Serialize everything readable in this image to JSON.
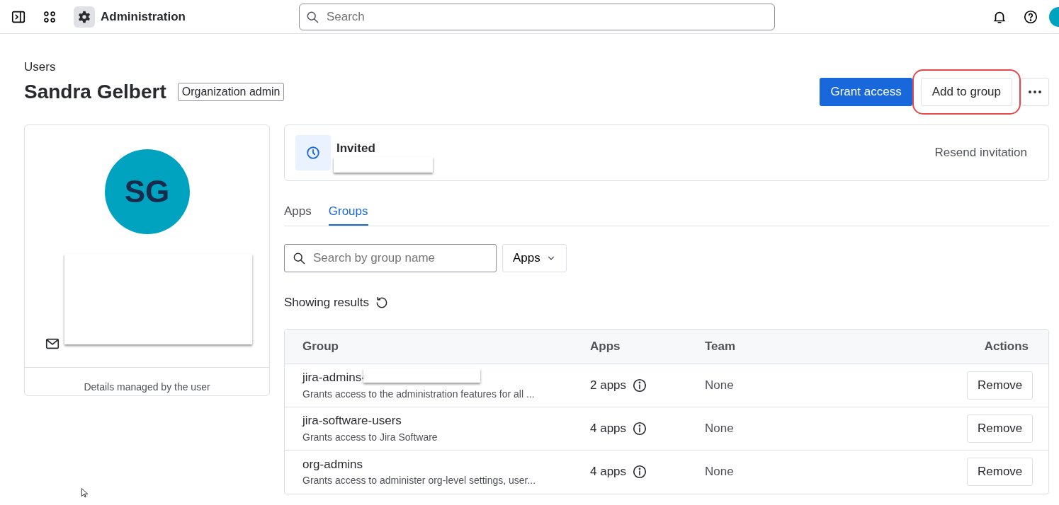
{
  "topbar": {
    "title": "Administration",
    "search_placeholder": "Search"
  },
  "header": {
    "breadcrumb": "Users",
    "name": "Sandra Gelbert",
    "role": "Organization admin",
    "buttons": [
      {
        "label": "Grant access",
        "kind": "primary",
        "highlighted": false
      },
      {
        "label": "Add to group",
        "kind": "default",
        "highlighted": true
      }
    ]
  },
  "profile": {
    "initials": "SG",
    "footer": "Details managed by the user"
  },
  "status": {
    "label": "Invited",
    "action": "Resend invitation"
  },
  "tabs": [
    {
      "label": "Apps",
      "selected": false
    },
    {
      "label": "Groups",
      "selected": true
    }
  ],
  "filters": {
    "search_placeholder": "Search by group name",
    "dropdown": "Apps"
  },
  "results_label": "Showing results",
  "table": {
    "columns": [
      "Group",
      "Apps",
      "Team",
      "Actions"
    ],
    "rows": [
      {
        "name": "jira-admins-",
        "redacted": true,
        "description": "Grants access to the administration features for all ...",
        "apps": "2 apps",
        "team": "None",
        "action": "Remove"
      },
      {
        "name": "jira-software-users",
        "redacted": false,
        "description": "Grants access to Jira Software",
        "apps": "4 apps",
        "team": "None",
        "action": "Remove"
      },
      {
        "name": "org-admins",
        "redacted": false,
        "description": "Grants access to administer org-level settings, user...",
        "apps": "4 apps",
        "team": "None",
        "action": "Remove"
      }
    ]
  }
}
